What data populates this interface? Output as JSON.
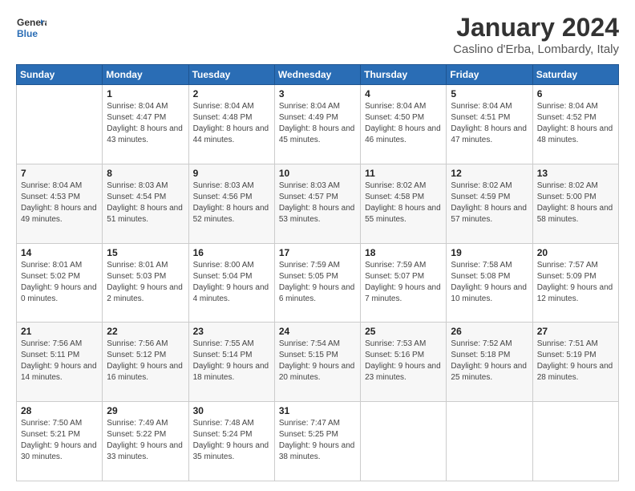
{
  "header": {
    "logo_line1": "General",
    "logo_line2": "Blue",
    "main_title": "January 2024",
    "subtitle": "Caslino d'Erba, Lombardy, Italy"
  },
  "days_of_week": [
    "Sunday",
    "Monday",
    "Tuesday",
    "Wednesday",
    "Thursday",
    "Friday",
    "Saturday"
  ],
  "weeks": [
    [
      {
        "day": "",
        "sunrise": "",
        "sunset": "",
        "daylight": ""
      },
      {
        "day": "1",
        "sunrise": "Sunrise: 8:04 AM",
        "sunset": "Sunset: 4:47 PM",
        "daylight": "Daylight: 8 hours and 43 minutes."
      },
      {
        "day": "2",
        "sunrise": "Sunrise: 8:04 AM",
        "sunset": "Sunset: 4:48 PM",
        "daylight": "Daylight: 8 hours and 44 minutes."
      },
      {
        "day": "3",
        "sunrise": "Sunrise: 8:04 AM",
        "sunset": "Sunset: 4:49 PM",
        "daylight": "Daylight: 8 hours and 45 minutes."
      },
      {
        "day": "4",
        "sunrise": "Sunrise: 8:04 AM",
        "sunset": "Sunset: 4:50 PM",
        "daylight": "Daylight: 8 hours and 46 minutes."
      },
      {
        "day": "5",
        "sunrise": "Sunrise: 8:04 AM",
        "sunset": "Sunset: 4:51 PM",
        "daylight": "Daylight: 8 hours and 47 minutes."
      },
      {
        "day": "6",
        "sunrise": "Sunrise: 8:04 AM",
        "sunset": "Sunset: 4:52 PM",
        "daylight": "Daylight: 8 hours and 48 minutes."
      }
    ],
    [
      {
        "day": "7",
        "sunrise": "Sunrise: 8:04 AM",
        "sunset": "Sunset: 4:53 PM",
        "daylight": "Daylight: 8 hours and 49 minutes."
      },
      {
        "day": "8",
        "sunrise": "Sunrise: 8:03 AM",
        "sunset": "Sunset: 4:54 PM",
        "daylight": "Daylight: 8 hours and 51 minutes."
      },
      {
        "day": "9",
        "sunrise": "Sunrise: 8:03 AM",
        "sunset": "Sunset: 4:56 PM",
        "daylight": "Daylight: 8 hours and 52 minutes."
      },
      {
        "day": "10",
        "sunrise": "Sunrise: 8:03 AM",
        "sunset": "Sunset: 4:57 PM",
        "daylight": "Daylight: 8 hours and 53 minutes."
      },
      {
        "day": "11",
        "sunrise": "Sunrise: 8:02 AM",
        "sunset": "Sunset: 4:58 PM",
        "daylight": "Daylight: 8 hours and 55 minutes."
      },
      {
        "day": "12",
        "sunrise": "Sunrise: 8:02 AM",
        "sunset": "Sunset: 4:59 PM",
        "daylight": "Daylight: 8 hours and 57 minutes."
      },
      {
        "day": "13",
        "sunrise": "Sunrise: 8:02 AM",
        "sunset": "Sunset: 5:00 PM",
        "daylight": "Daylight: 8 hours and 58 minutes."
      }
    ],
    [
      {
        "day": "14",
        "sunrise": "Sunrise: 8:01 AM",
        "sunset": "Sunset: 5:02 PM",
        "daylight": "Daylight: 9 hours and 0 minutes."
      },
      {
        "day": "15",
        "sunrise": "Sunrise: 8:01 AM",
        "sunset": "Sunset: 5:03 PM",
        "daylight": "Daylight: 9 hours and 2 minutes."
      },
      {
        "day": "16",
        "sunrise": "Sunrise: 8:00 AM",
        "sunset": "Sunset: 5:04 PM",
        "daylight": "Daylight: 9 hours and 4 minutes."
      },
      {
        "day": "17",
        "sunrise": "Sunrise: 7:59 AM",
        "sunset": "Sunset: 5:05 PM",
        "daylight": "Daylight: 9 hours and 6 minutes."
      },
      {
        "day": "18",
        "sunrise": "Sunrise: 7:59 AM",
        "sunset": "Sunset: 5:07 PM",
        "daylight": "Daylight: 9 hours and 7 minutes."
      },
      {
        "day": "19",
        "sunrise": "Sunrise: 7:58 AM",
        "sunset": "Sunset: 5:08 PM",
        "daylight": "Daylight: 9 hours and 10 minutes."
      },
      {
        "day": "20",
        "sunrise": "Sunrise: 7:57 AM",
        "sunset": "Sunset: 5:09 PM",
        "daylight": "Daylight: 9 hours and 12 minutes."
      }
    ],
    [
      {
        "day": "21",
        "sunrise": "Sunrise: 7:56 AM",
        "sunset": "Sunset: 5:11 PM",
        "daylight": "Daylight: 9 hours and 14 minutes."
      },
      {
        "day": "22",
        "sunrise": "Sunrise: 7:56 AM",
        "sunset": "Sunset: 5:12 PM",
        "daylight": "Daylight: 9 hours and 16 minutes."
      },
      {
        "day": "23",
        "sunrise": "Sunrise: 7:55 AM",
        "sunset": "Sunset: 5:14 PM",
        "daylight": "Daylight: 9 hours and 18 minutes."
      },
      {
        "day": "24",
        "sunrise": "Sunrise: 7:54 AM",
        "sunset": "Sunset: 5:15 PM",
        "daylight": "Daylight: 9 hours and 20 minutes."
      },
      {
        "day": "25",
        "sunrise": "Sunrise: 7:53 AM",
        "sunset": "Sunset: 5:16 PM",
        "daylight": "Daylight: 9 hours and 23 minutes."
      },
      {
        "day": "26",
        "sunrise": "Sunrise: 7:52 AM",
        "sunset": "Sunset: 5:18 PM",
        "daylight": "Daylight: 9 hours and 25 minutes."
      },
      {
        "day": "27",
        "sunrise": "Sunrise: 7:51 AM",
        "sunset": "Sunset: 5:19 PM",
        "daylight": "Daylight: 9 hours and 28 minutes."
      }
    ],
    [
      {
        "day": "28",
        "sunrise": "Sunrise: 7:50 AM",
        "sunset": "Sunset: 5:21 PM",
        "daylight": "Daylight: 9 hours and 30 minutes."
      },
      {
        "day": "29",
        "sunrise": "Sunrise: 7:49 AM",
        "sunset": "Sunset: 5:22 PM",
        "daylight": "Daylight: 9 hours and 33 minutes."
      },
      {
        "day": "30",
        "sunrise": "Sunrise: 7:48 AM",
        "sunset": "Sunset: 5:24 PM",
        "daylight": "Daylight: 9 hours and 35 minutes."
      },
      {
        "day": "31",
        "sunrise": "Sunrise: 7:47 AM",
        "sunset": "Sunset: 5:25 PM",
        "daylight": "Daylight: 9 hours and 38 minutes."
      },
      {
        "day": "",
        "sunrise": "",
        "sunset": "",
        "daylight": ""
      },
      {
        "day": "",
        "sunrise": "",
        "sunset": "",
        "daylight": ""
      },
      {
        "day": "",
        "sunrise": "",
        "sunset": "",
        "daylight": ""
      }
    ]
  ]
}
